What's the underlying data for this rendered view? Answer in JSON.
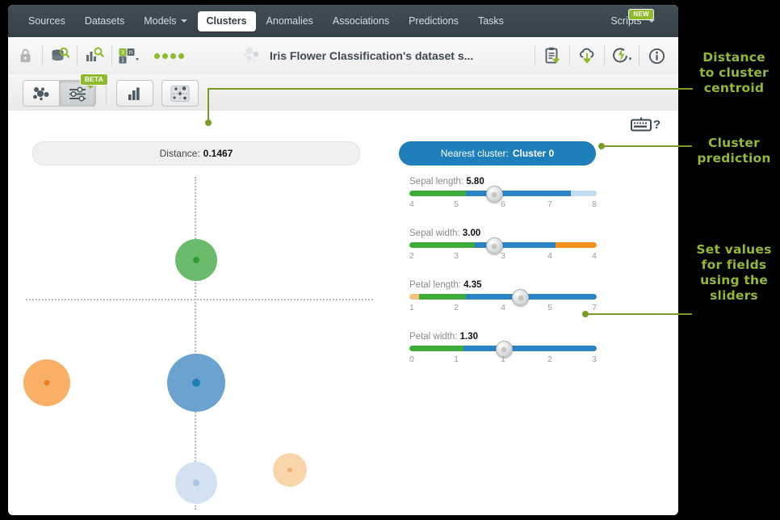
{
  "nav": {
    "items": [
      {
        "label": "Sources",
        "active": false,
        "caret": false
      },
      {
        "label": "Datasets",
        "active": false,
        "caret": false
      },
      {
        "label": "Models",
        "active": false,
        "caret": true
      },
      {
        "label": "Clusters",
        "active": true,
        "caret": false
      },
      {
        "label": "Anomalies",
        "active": false,
        "caret": false
      },
      {
        "label": "Associations",
        "active": false,
        "caret": false
      },
      {
        "label": "Predictions",
        "active": false,
        "caret": false
      },
      {
        "label": "Tasks",
        "active": false,
        "caret": false
      }
    ],
    "scripts_label": "Scripts",
    "new_badge": "NEW"
  },
  "toolbar": {
    "title": "Iris Flower Classification's dataset s...",
    "left_icons": [
      "lock-icon",
      "dataset-search-icon",
      "model-search-icon",
      "cluster-config-icon"
    ],
    "dots_count": 4,
    "right_icons": [
      "clipboard-download-icon",
      "cloud-download-icon",
      "flash-actions-icon",
      "info-icon"
    ]
  },
  "subbar": {
    "views": [
      {
        "icon": "cluster-graph-icon",
        "selected": false
      },
      {
        "icon": "sliders-icon",
        "selected": true,
        "badge": "BETA"
      },
      {
        "icon": "bar-chart-icon",
        "selected": false
      },
      {
        "icon": "scatter-matrix-icon",
        "selected": false
      }
    ]
  },
  "content": {
    "keyboard_help": "?",
    "distance": {
      "label": "Distance:",
      "value": "0.1467"
    },
    "nearest_cluster": {
      "label": "Nearest cluster:",
      "value": "Cluster 0"
    }
  },
  "sliders": [
    {
      "name": "Sepal length:",
      "value": "5.80",
      "ticks": [
        "4",
        "5",
        "6",
        "7",
        "8"
      ],
      "knob_pct": 45,
      "segments": [
        {
          "color": "#3eaa3a",
          "start": 0,
          "end": 30
        },
        {
          "color": "#2a83c4",
          "start": 30,
          "end": 86
        },
        {
          "color": "#c3dcef",
          "start": 86,
          "end": 100
        }
      ]
    },
    {
      "name": "Sepal width:",
      "value": "3.00",
      "ticks": [
        "2",
        "3",
        "3",
        "4",
        "4"
      ],
      "knob_pct": 45,
      "segments": [
        {
          "color": "#3eaa3a",
          "start": 0,
          "end": 35
        },
        {
          "color": "#2a83c4",
          "start": 35,
          "end": 78
        },
        {
          "color": "#f5921e",
          "start": 78,
          "end": 100
        }
      ]
    },
    {
      "name": "Petal length:",
      "value": "4.35",
      "ticks": [
        "1",
        "2",
        "4",
        "5",
        "7"
      ],
      "knob_pct": 59,
      "segments": [
        {
          "color": "#f8c07a",
          "start": 0,
          "end": 5
        },
        {
          "color": "#3eaa3a",
          "start": 5,
          "end": 30
        },
        {
          "color": "#2a83c4",
          "start": 30,
          "end": 100
        }
      ]
    },
    {
      "name": "Petal width:",
      "value": "1.30",
      "ticks": [
        "0",
        "1",
        "1",
        "2",
        "3"
      ],
      "knob_pct": 50,
      "segments": [
        {
          "color": "#3eaa3a",
          "start": 0,
          "end": 29
        },
        {
          "color": "#2a83c4",
          "start": 29,
          "end": 100
        }
      ]
    }
  ],
  "chart_data": {
    "type": "scatter",
    "title": "",
    "xlabel": "",
    "ylabel": "",
    "grid": true,
    "legend": "none",
    "points": [
      {
        "name": "cluster-orange-left",
        "x": 6,
        "y": 62,
        "r": 29,
        "color": "#f7b066",
        "core_color": "#f1801c",
        "core_r": 7
      },
      {
        "name": "cluster-green-top",
        "x": 49,
        "y": 25,
        "r": 26,
        "color": "#6cbb6c",
        "core_color": "#2e9e34",
        "core_r": 8
      },
      {
        "name": "cluster-blue-center",
        "x": 49,
        "y": 62,
        "r": 36,
        "color": "#6ba3ce",
        "core_color": "#1f7fba",
        "core_r": 10
      },
      {
        "name": "cluster-lightblue-bottom",
        "x": 49,
        "y": 92,
        "r": 26,
        "color": "#d3e2f1",
        "core_color": "#a9c6e2",
        "core_r": 8
      },
      {
        "name": "cluster-orange-right",
        "x": 76,
        "y": 88,
        "r": 21,
        "color": "#fad4ab",
        "core_color": "#f1b070",
        "core_r": 6
      }
    ]
  },
  "annotations": [
    {
      "id": "distance-annotation",
      "lines": [
        "Distance",
        "to cluster",
        "centroid"
      ]
    },
    {
      "id": "cluster-prediction-annotation",
      "lines": [
        "Cluster",
        "prediction"
      ]
    },
    {
      "id": "sliders-annotation",
      "lines": [
        "Set values",
        "for fields",
        "using the",
        "sliders"
      ]
    }
  ]
}
